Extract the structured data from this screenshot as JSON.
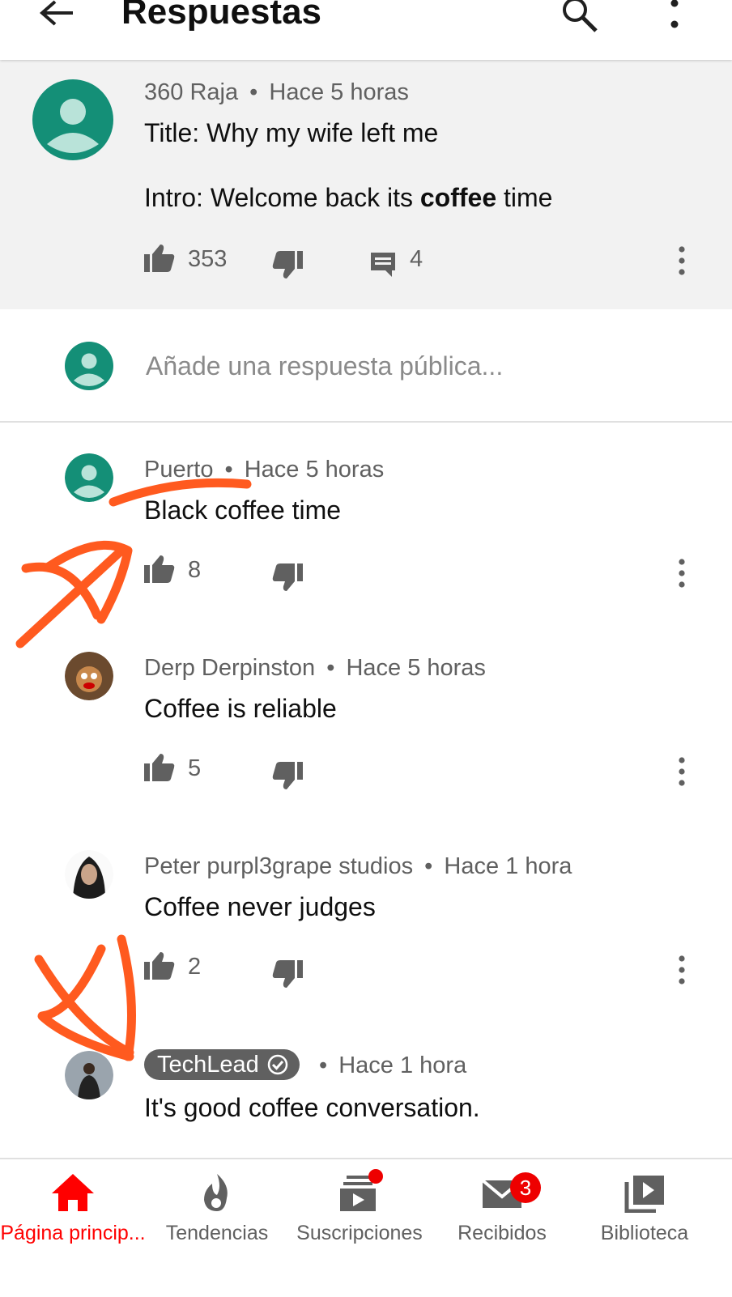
{
  "header": {
    "title": "Respuestas"
  },
  "parent_comment": {
    "author": "360 Raja",
    "time": "Hace 5 horas",
    "line1": "Title: Why my wife left me",
    "line2_prefix": "Intro: Welcome back its ",
    "line2_bold": "coffee",
    "line2_suffix": " time",
    "likes": "353",
    "replies": "4"
  },
  "reply_box": {
    "placeholder": "Añade una respuesta pública..."
  },
  "comments": [
    {
      "author": "Puerto",
      "time": "Hace 5 horas",
      "text": "Black coffee time",
      "likes": "8"
    },
    {
      "author": "Derp Derpinston",
      "time": "Hace 5 horas",
      "text": "Coffee is reliable",
      "likes": "5"
    },
    {
      "author": "Peter purpl3grape studios",
      "time": "Hace 1 hora",
      "text": "Coffee never judges",
      "likes": "2"
    },
    {
      "author": "TechLead",
      "time": "Hace 1 hora",
      "text": "It's good coffee conversation."
    }
  ],
  "separator": "•",
  "bottom_nav": [
    {
      "label": "Página princip..."
    },
    {
      "label": "Tendencias"
    },
    {
      "label": "Suscripciones"
    },
    {
      "label": "Recibidos",
      "badge": "3"
    },
    {
      "label": "Biblioteca"
    }
  ],
  "colors": {
    "accent": "#ff0000",
    "avatar_teal": "#148f77",
    "annotation": "#ff5a1f"
  }
}
